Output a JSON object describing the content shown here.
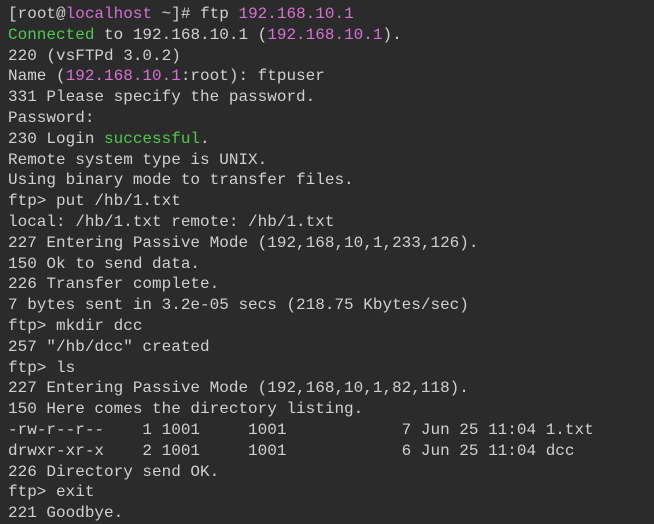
{
  "prompt": {
    "open_bracket": "[",
    "user": "root",
    "at": "@",
    "host": "localhost",
    "path_prompt": " ~]# ",
    "cmd": "ftp ",
    "ip": "192.168.10.1"
  },
  "connected": {
    "word": "Connected",
    "mid": " to 192.168.10.1 (",
    "ip": "192.168.10.1",
    "end": ")."
  },
  "banner": "220 (vsFTPd 3.0.2)",
  "name_line": {
    "pre": "Name (",
    "ip": "192.168.10.1",
    "mid": ":root): ",
    "val": "ftpuser"
  },
  "resp331": "331 Please specify the password.",
  "password": "Password:",
  "login": {
    "pre": "230 Login ",
    "word": "successful",
    "end": "."
  },
  "systype": "Remote system type is UNIX.",
  "binmode": "Using binary mode to transfer files.",
  "put_line": {
    "prompt": "ftp> ",
    "cmd": "put /hb/1.txt"
  },
  "local_remote": "local: /hb/1.txt remote: /hb/1.txt",
  "pasv1": "227 Entering Passive Mode (192,168,10,1,233,126).",
  "ok_send": "150 Ok to send data.",
  "transfer_complete": "226 Transfer complete.",
  "bytes_sent": "7 bytes sent in 3.2e-05 secs (218.75 Kbytes/sec)",
  "mkdir_line": {
    "prompt": "ftp> ",
    "cmd": "mkdir dcc"
  },
  "created": "257 \"/hb/dcc\" created",
  "ls_line": {
    "prompt": "ftp> ",
    "cmd": "ls"
  },
  "pasv2": "227 Entering Passive Mode (192,168,10,1,82,118).",
  "dir_listing": "150 Here comes the directory listing.",
  "file1": "-rw-r--r--    1 1001     1001            7 Jun 25 11:04 1.txt",
  "file2": "drwxr-xr-x    2 1001     1001            6 Jun 25 11:04 dcc",
  "dir_ok": "226 Directory send OK.",
  "exit_line": {
    "prompt": "ftp> ",
    "cmd": "exit"
  },
  "goodbye": "221 Goodbye."
}
